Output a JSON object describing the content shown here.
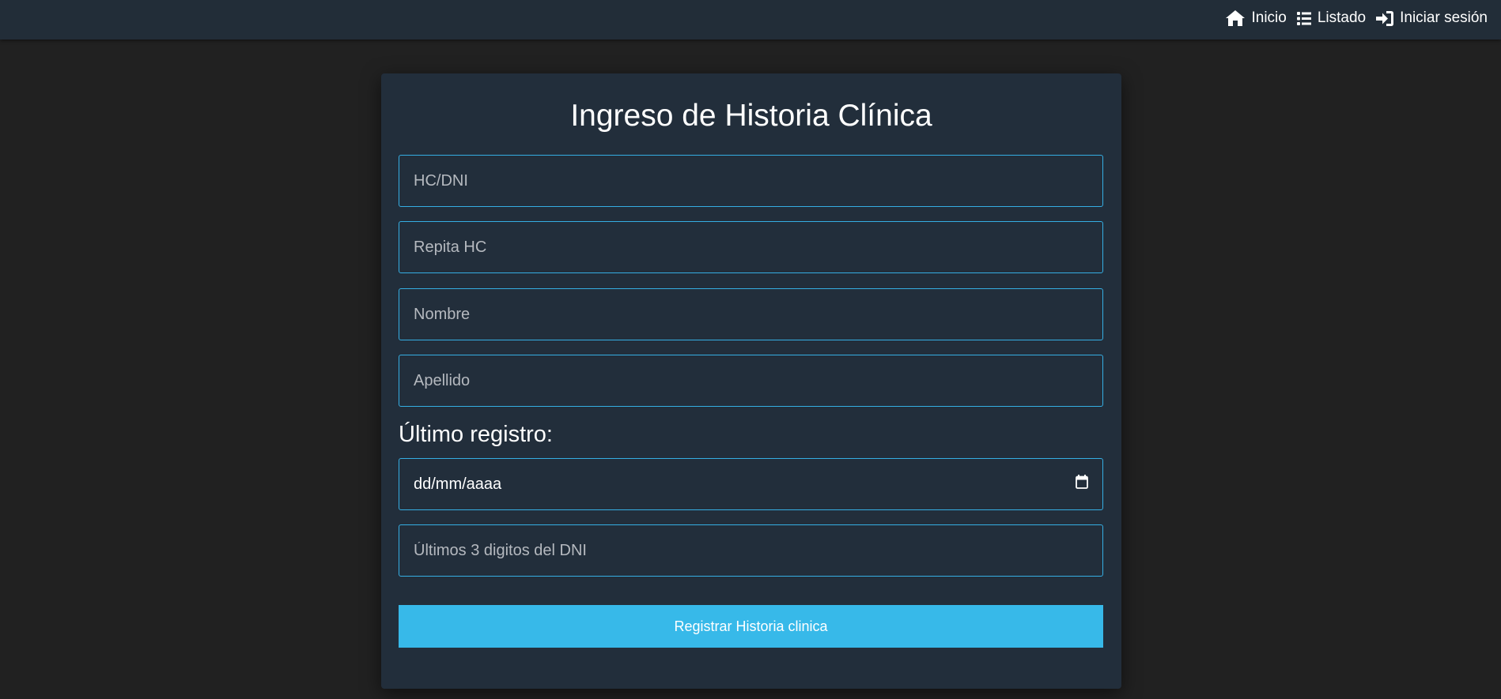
{
  "nav": {
    "items": [
      {
        "label": "Inicio",
        "icon": "home-icon"
      },
      {
        "label": "Listado",
        "icon": "list-icon"
      },
      {
        "label": "Iniciar sesión",
        "icon": "sign-in-icon"
      }
    ]
  },
  "form": {
    "title": "Ingreso de Historia Clínica",
    "hc_placeholder": "HC/DNI",
    "repeat_hc_placeholder": "Repita HC",
    "name_placeholder": "Nombre",
    "lastname_placeholder": "Apellido",
    "last_record_label": "Último registro:",
    "date_value": "dd/mm/aaaa",
    "dni_digits_placeholder": "Últimos 3 digitos del DNI",
    "submit_label": "Registrar Historia clinica"
  },
  "colors": {
    "page_background": "#212121",
    "navbar_background": "#222d38",
    "card_background": "#222e3b",
    "accent": "#37b9e9",
    "field_border": "#35aee3"
  }
}
